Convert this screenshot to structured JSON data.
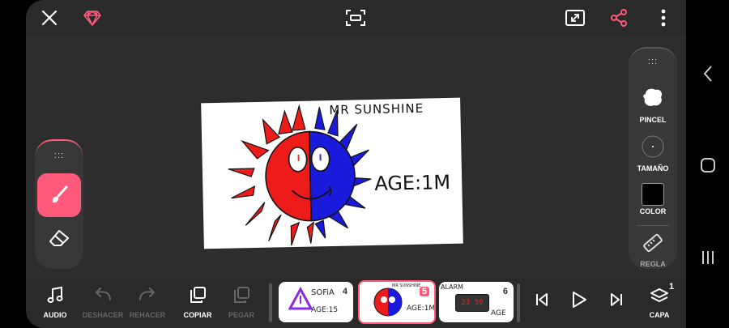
{
  "colors": {
    "accent": "#ff5a7a",
    "panel": "#383838",
    "bg": "#2a2a2a"
  },
  "topbar": {
    "icons": [
      "close-icon",
      "gem-icon",
      "crop-icon",
      "expand-icon",
      "share-icon",
      "more-vert-icon"
    ]
  },
  "drawing": {
    "title": "MR SUNSHINE",
    "age": "AGE:1M"
  },
  "left_tools": {
    "grip": ":::",
    "active_tool": "brush",
    "tools": [
      "brush-icon",
      "eraser-icon"
    ]
  },
  "right_panel": {
    "grip": ":::",
    "pincel": "PINCEL",
    "tamano": "TAMAÑO",
    "color": "COLOR",
    "regla": "REGLA",
    "brush_color": "#000000"
  },
  "bottombar": {
    "audio": "AUDIO",
    "deshacer": "DESHACER",
    "rehacer": "REHACER",
    "copiar": "COPIAR",
    "pegar": "PEGAR",
    "capa": "CAPA",
    "capa_count": "1"
  },
  "frames": [
    {
      "number": "4",
      "line1": "SOFiA",
      "line2": "AGE:15",
      "active": false
    },
    {
      "number": "5",
      "line1": "MR SUNSHINE",
      "line2": "AGE:1M",
      "active": true
    },
    {
      "number": "6",
      "line1": "ALARM",
      "clock": "23 59",
      "line2": "AGE",
      "active": false
    }
  ]
}
